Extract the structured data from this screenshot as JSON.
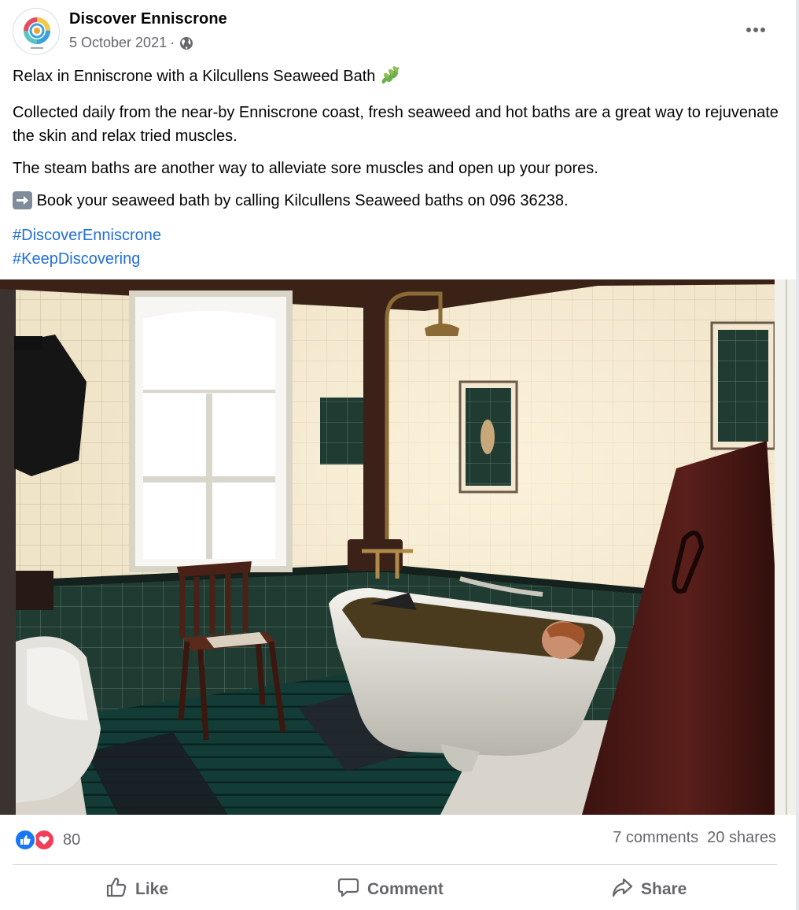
{
  "post": {
    "page_name": "Discover Enniscrone",
    "date": "5 October 2021",
    "separator": "·",
    "privacy_icon": "globe-icon",
    "more_icon": "more-options-icon"
  },
  "content": {
    "line1": "Relax in Enniscrone with a Kilcullens Seaweed Bath",
    "line1_emoji": "herb-emoji",
    "para2": "Collected daily from the near-by Enniscrone coast, fresh seaweed and hot baths are a great way to rejuvenate the skin and relax tried muscles.",
    "para3": "The steam baths are another way to alleviate sore muscles and open up your pores.",
    "para4_emoji": "right-arrow-emoji",
    "para4": "Book your seaweed bath by calling Kilcullens Seaweed baths on 096 36238.",
    "hashtags": [
      "#DiscoverEnniscrone",
      "#KeepDiscovering"
    ]
  },
  "engagement": {
    "reaction_icons": [
      "like-reaction-icon",
      "love-reaction-icon"
    ],
    "reaction_count": "80",
    "comments": "7 comments",
    "shares": "20 shares"
  },
  "actions": {
    "like": "Like",
    "comment": "Comment",
    "share": "Share"
  },
  "colors": {
    "link": "#216fdb",
    "secondary_text": "#65676b",
    "like_blue": "#1877f2",
    "love_red": "#f33e58"
  }
}
